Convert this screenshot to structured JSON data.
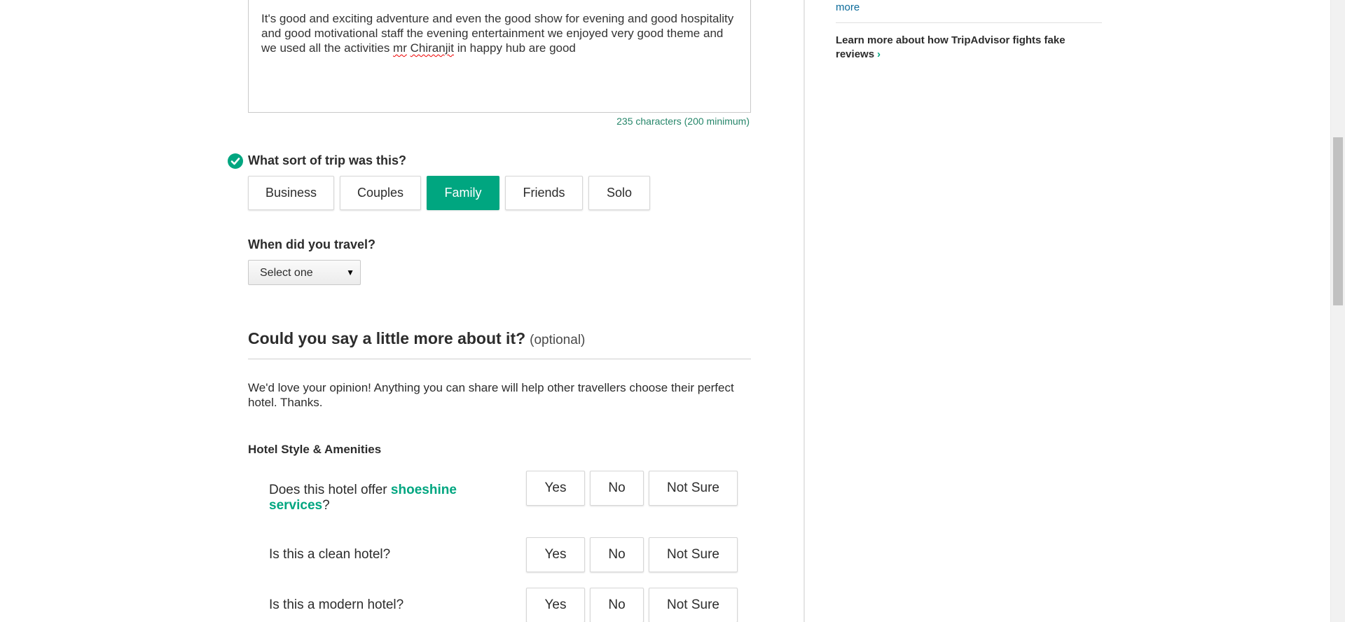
{
  "review": {
    "text_part1": "It's good and exciting adventure and even the good show for evening and good hospitality and good motivational staff the evening entertainment we enjoyed very good theme and we used all the activities ",
    "word_mr": "mr",
    "space": " ",
    "word_chiranjit": "Chiranjit",
    "text_part2": " in happy hub are good",
    "char_count": "235 characters (200 minimum)"
  },
  "trip_type": {
    "question": "What sort of trip was this?",
    "options": [
      "Business",
      "Couples",
      "Family",
      "Friends",
      "Solo"
    ],
    "selected": "Family"
  },
  "travel_date": {
    "question": "When did you travel?",
    "select_value": "Select one",
    "arrow": "▼"
  },
  "more_section": {
    "title": "Could you say a little more about it?",
    "optional": "(optional)",
    "intro": "We'd love your opinion! Anything you can share will help other travellers choose their perfect hotel. Thanks.",
    "subheading": "Hotel Style & Amenities",
    "questions": [
      {
        "prefix": "Does this hotel offer ",
        "link": "shoeshine services",
        "suffix": "?"
      },
      {
        "text": "Is this a clean hotel?"
      },
      {
        "text": "Is this a modern hotel?"
      }
    ],
    "answers": [
      "Yes",
      "No",
      "Not Sure"
    ]
  },
  "sidebar": {
    "more_link": "more",
    "learn_more": "Learn more about how TripAdvisor fights fake reviews",
    "chevron": "›"
  },
  "colors": {
    "accent": "#00a680",
    "link": "#0c6b9a",
    "char_count": "#26866a"
  }
}
